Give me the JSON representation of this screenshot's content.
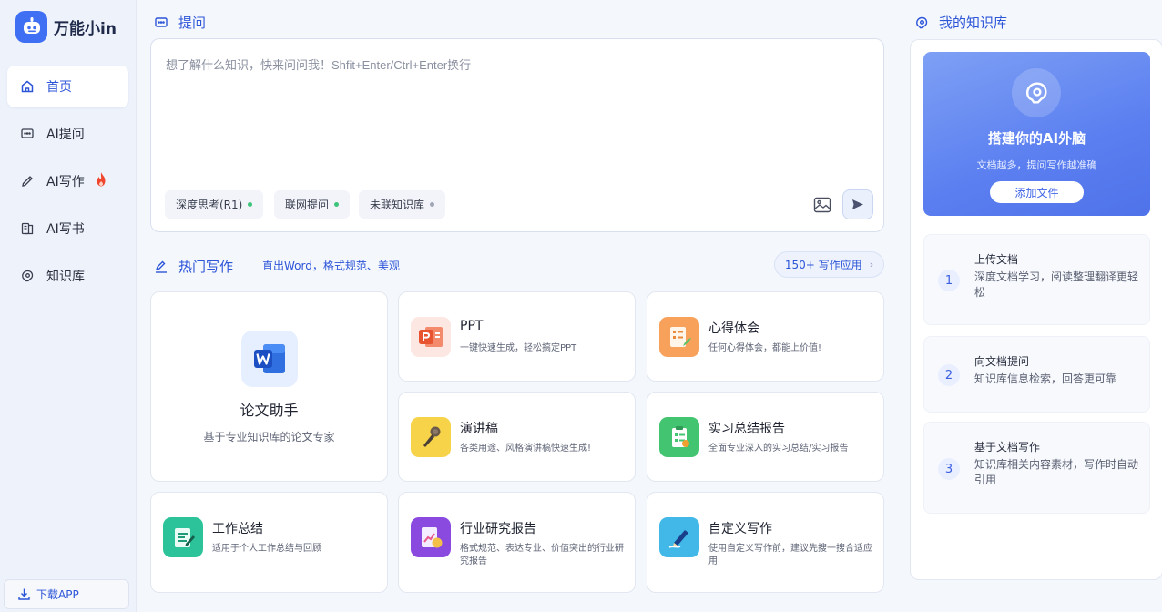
{
  "sidebar": {
    "brand": "万能小in",
    "items": [
      {
        "label": "首页",
        "icon": "home-icon",
        "active": true
      },
      {
        "label": "AI提问",
        "icon": "chat-icon"
      },
      {
        "label": "AI写作",
        "icon": "pen-icon",
        "badge": "fire-icon"
      },
      {
        "label": "AI写书",
        "icon": "book-icon"
      },
      {
        "label": "知识库",
        "icon": "brain-icon"
      }
    ],
    "download": "下载APP"
  },
  "ask": {
    "title": "提问",
    "placeholder": "想了解什么知识，快来问问我！Shfit+Enter/Ctrl+Enter换行",
    "chips": [
      {
        "label": "深度思考(R1)",
        "status_color": "#3cc47a"
      },
      {
        "label": "联网提问",
        "status_color": "#3cc47a"
      },
      {
        "label": "未联知识库",
        "status_color": "#a0a6b4"
      }
    ]
  },
  "hot": {
    "title": "热门写作",
    "subtitle": "直出Word，格式规范、美观",
    "more": "150+ 写作应用",
    "featured": {
      "title": "论文助手",
      "desc": "基于专业知识库的论文专家",
      "icon": "word-icon"
    },
    "cards": [
      {
        "title": "PPT",
        "desc": "一键快速生成，轻松搞定PPT",
        "icon": "ppt-icon"
      },
      {
        "title": "心得体会",
        "desc": "任何心得体会，都能上价值!",
        "icon": "notes-icon"
      },
      {
        "title": "演讲稿",
        "desc": "各类用途、风格演讲稿快速生成!",
        "icon": "microphone-icon"
      },
      {
        "title": "实习总结报告",
        "desc": "全面专业深入的实习总结/实习报告",
        "icon": "clipboard-icon"
      },
      {
        "title": "工作总结",
        "desc": "适用于个人工作总结与回顾",
        "icon": "summary-icon"
      },
      {
        "title": "行业研究报告",
        "desc": "格式规范、表达专业、价值突出的行业研究报告",
        "icon": "report-icon"
      },
      {
        "title": "自定义写作",
        "desc": "使用自定义写作前，建议先搜一搜合适应用",
        "icon": "custom-pen-icon"
      }
    ]
  },
  "knowledge": {
    "title": "我的知识库",
    "banner": {
      "title": "搭建你的AI外脑",
      "subtitle": "文档越多，提问写作越准确",
      "button": "添加文件"
    },
    "steps": [
      {
        "num": "1",
        "title": "上传文档",
        "desc": "深度文档学习，阅读整理翻译更轻松"
      },
      {
        "num": "2",
        "title": "向文档提问",
        "desc": "知识库信息检索，回答更可靠"
      },
      {
        "num": "3",
        "title": "基于文档写作",
        "desc": "知识库相关内容素材，写作时自动引用"
      }
    ]
  },
  "colors": {
    "accent": "#2d55d8",
    "brand": "#3f6ff3"
  }
}
